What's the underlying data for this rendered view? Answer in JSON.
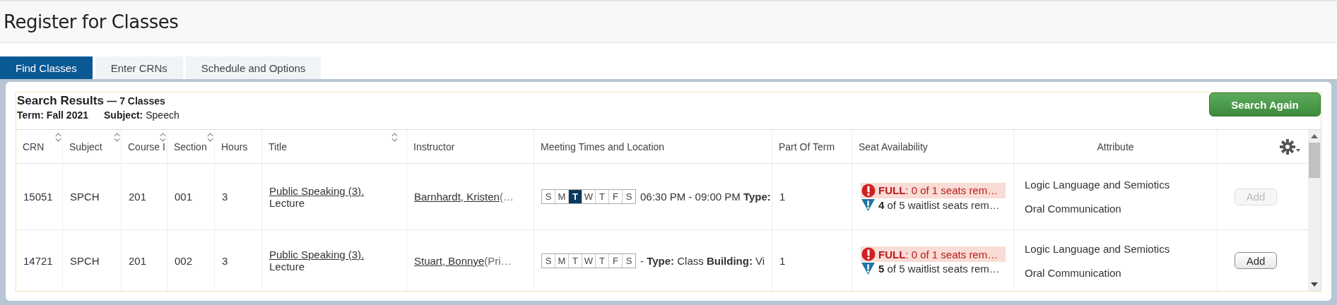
{
  "page_title": "Register for Classes",
  "tabs": [
    {
      "label": "Find Classes",
      "selected": true
    },
    {
      "label": "Enter CRNs",
      "selected": false
    },
    {
      "label": "Schedule and Options",
      "selected": false
    }
  ],
  "results": {
    "heading": "Search Results",
    "count": "— 7 Classes",
    "term_label": "Term:",
    "term": "Fall 2021",
    "subject_label": "Subject:",
    "subject": "Speech",
    "search_again": "Search Again"
  },
  "columns": [
    {
      "label": "CRN",
      "sortable": true
    },
    {
      "label": "Subject",
      "sortable": true
    },
    {
      "label": "Course I",
      "sortable": true
    },
    {
      "label": "Section",
      "sortable": true
    },
    {
      "label": "Hours",
      "sortable": false
    },
    {
      "label": "Title",
      "sortable": true
    },
    {
      "label": "Instructor",
      "sortable": false
    },
    {
      "label": "Meeting Times and Location",
      "sortable": false
    },
    {
      "label": "Part Of Term",
      "sortable": false
    },
    {
      "label": "Seat Availability",
      "sortable": false
    },
    {
      "label": "Attribute",
      "sortable": false
    }
  ],
  "rows": [
    {
      "crn": "15051",
      "subject": "SPCH",
      "course": "201",
      "section": "001",
      "hours": "3",
      "title": "Public Speaking (3).",
      "schedule_type": "Lecture",
      "instructor": "Barnhardt, Kristen",
      "instructor_note": " (…",
      "days": [
        {
          "label": "S",
          "selected": false
        },
        {
          "label": "M",
          "selected": false
        },
        {
          "label": "T",
          "selected": true
        },
        {
          "label": "W",
          "selected": false
        },
        {
          "label": "T",
          "selected": false
        },
        {
          "label": "F",
          "selected": false
        },
        {
          "label": "S",
          "selected": false
        }
      ],
      "meeting": "06:30 PM - 09:00 PM **Type:**",
      "part_of_term": "1",
      "seat_status": "FULL",
      "seats": ": 0 of 1 seats rem…",
      "waitlist_count": "4",
      "waitlist": " of 5 waitlist seats rem…",
      "attributes": [
        "Logic Language and Semiotics",
        "Oral Communication"
      ],
      "add": {
        "label": "Add",
        "disabled": true
      }
    },
    {
      "crn": "14721",
      "subject": "SPCH",
      "course": "201",
      "section": "002",
      "hours": "3",
      "title": "Public Speaking (3).",
      "schedule_type": "Lecture",
      "instructor": "Stuart, Bonnye",
      "instructor_note": " (Pri…",
      "days": [
        {
          "label": "S",
          "selected": false
        },
        {
          "label": "M",
          "selected": false
        },
        {
          "label": "T",
          "selected": false
        },
        {
          "label": "W",
          "selected": false
        },
        {
          "label": "T",
          "selected": false
        },
        {
          "label": "F",
          "selected": false
        },
        {
          "label": "S",
          "selected": false
        }
      ],
      "meeting": " - **Type:** Class  **Building:** Vi",
      "part_of_term": "1",
      "seat_status": "FULL",
      "seats": ": 0 of 1 seats rem…",
      "waitlist_count": "5",
      "waitlist": " of 5 waitlist seats rem…",
      "attributes": [
        "Logic Language and Semiotics",
        "Oral Communication"
      ],
      "add": {
        "label": "Add",
        "disabled": false
      }
    }
  ]
}
